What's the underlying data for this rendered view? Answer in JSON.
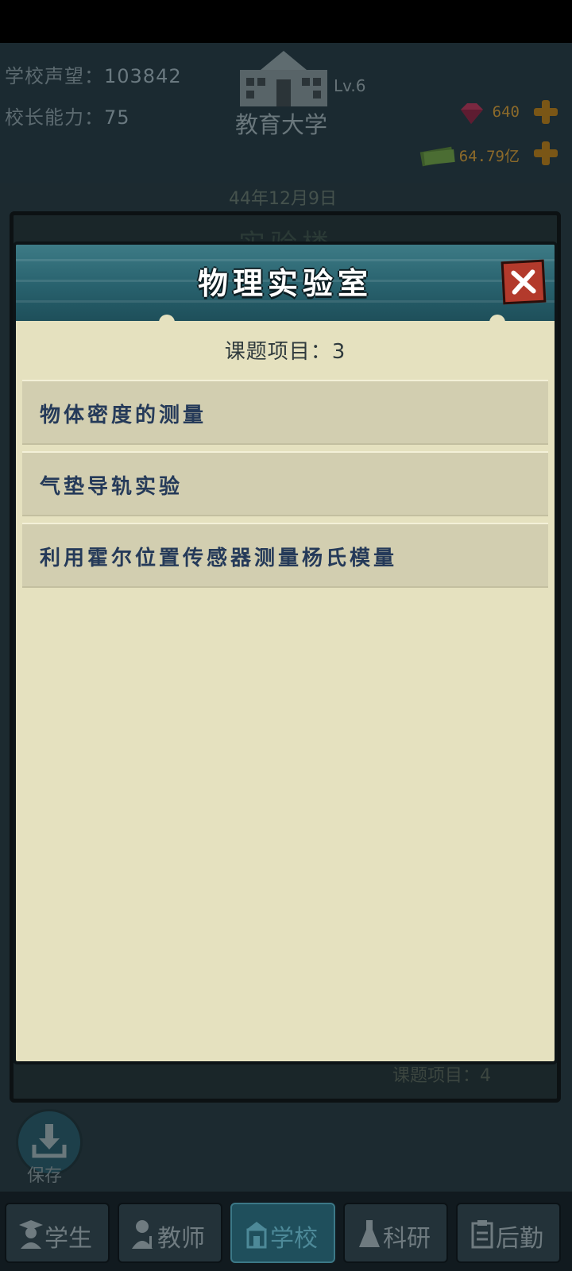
{
  "header": {
    "reputation_label": "学校声望：",
    "reputation_value": "103842",
    "principal_label": "校长能力：",
    "principal_value": "75",
    "school_level": "Lv.6",
    "school_name": "教育大学",
    "gems": "640",
    "money": "64.79亿",
    "date": "44年12月9日"
  },
  "background_panel": {
    "title": "实验楼",
    "footer_text": "课题项目：4"
  },
  "dialog": {
    "title": "物理实验室",
    "count_label": "课题项目：",
    "count_value": "3",
    "items": [
      {
        "label": "物体密度的测量"
      },
      {
        "label": "气垫导轨实验"
      },
      {
        "label": "利用霍尔位置传感器测量杨氏模量"
      }
    ]
  },
  "save": {
    "label": "保存"
  },
  "nav": {
    "tabs": [
      {
        "label": "学生",
        "icon": "student-icon"
      },
      {
        "label": "教师",
        "icon": "teacher-icon"
      },
      {
        "label": "学校",
        "icon": "school-icon",
        "active": true
      },
      {
        "label": "科研",
        "icon": "flask-icon"
      },
      {
        "label": "后勤",
        "icon": "clipboard-icon"
      }
    ]
  },
  "colors": {
    "dialog_bg": "#e5e1bf",
    "dialog_header": "#28616d",
    "item_bg": "#d2ceb0",
    "item_text": "#253a59",
    "close_button": "#b33a2c"
  }
}
